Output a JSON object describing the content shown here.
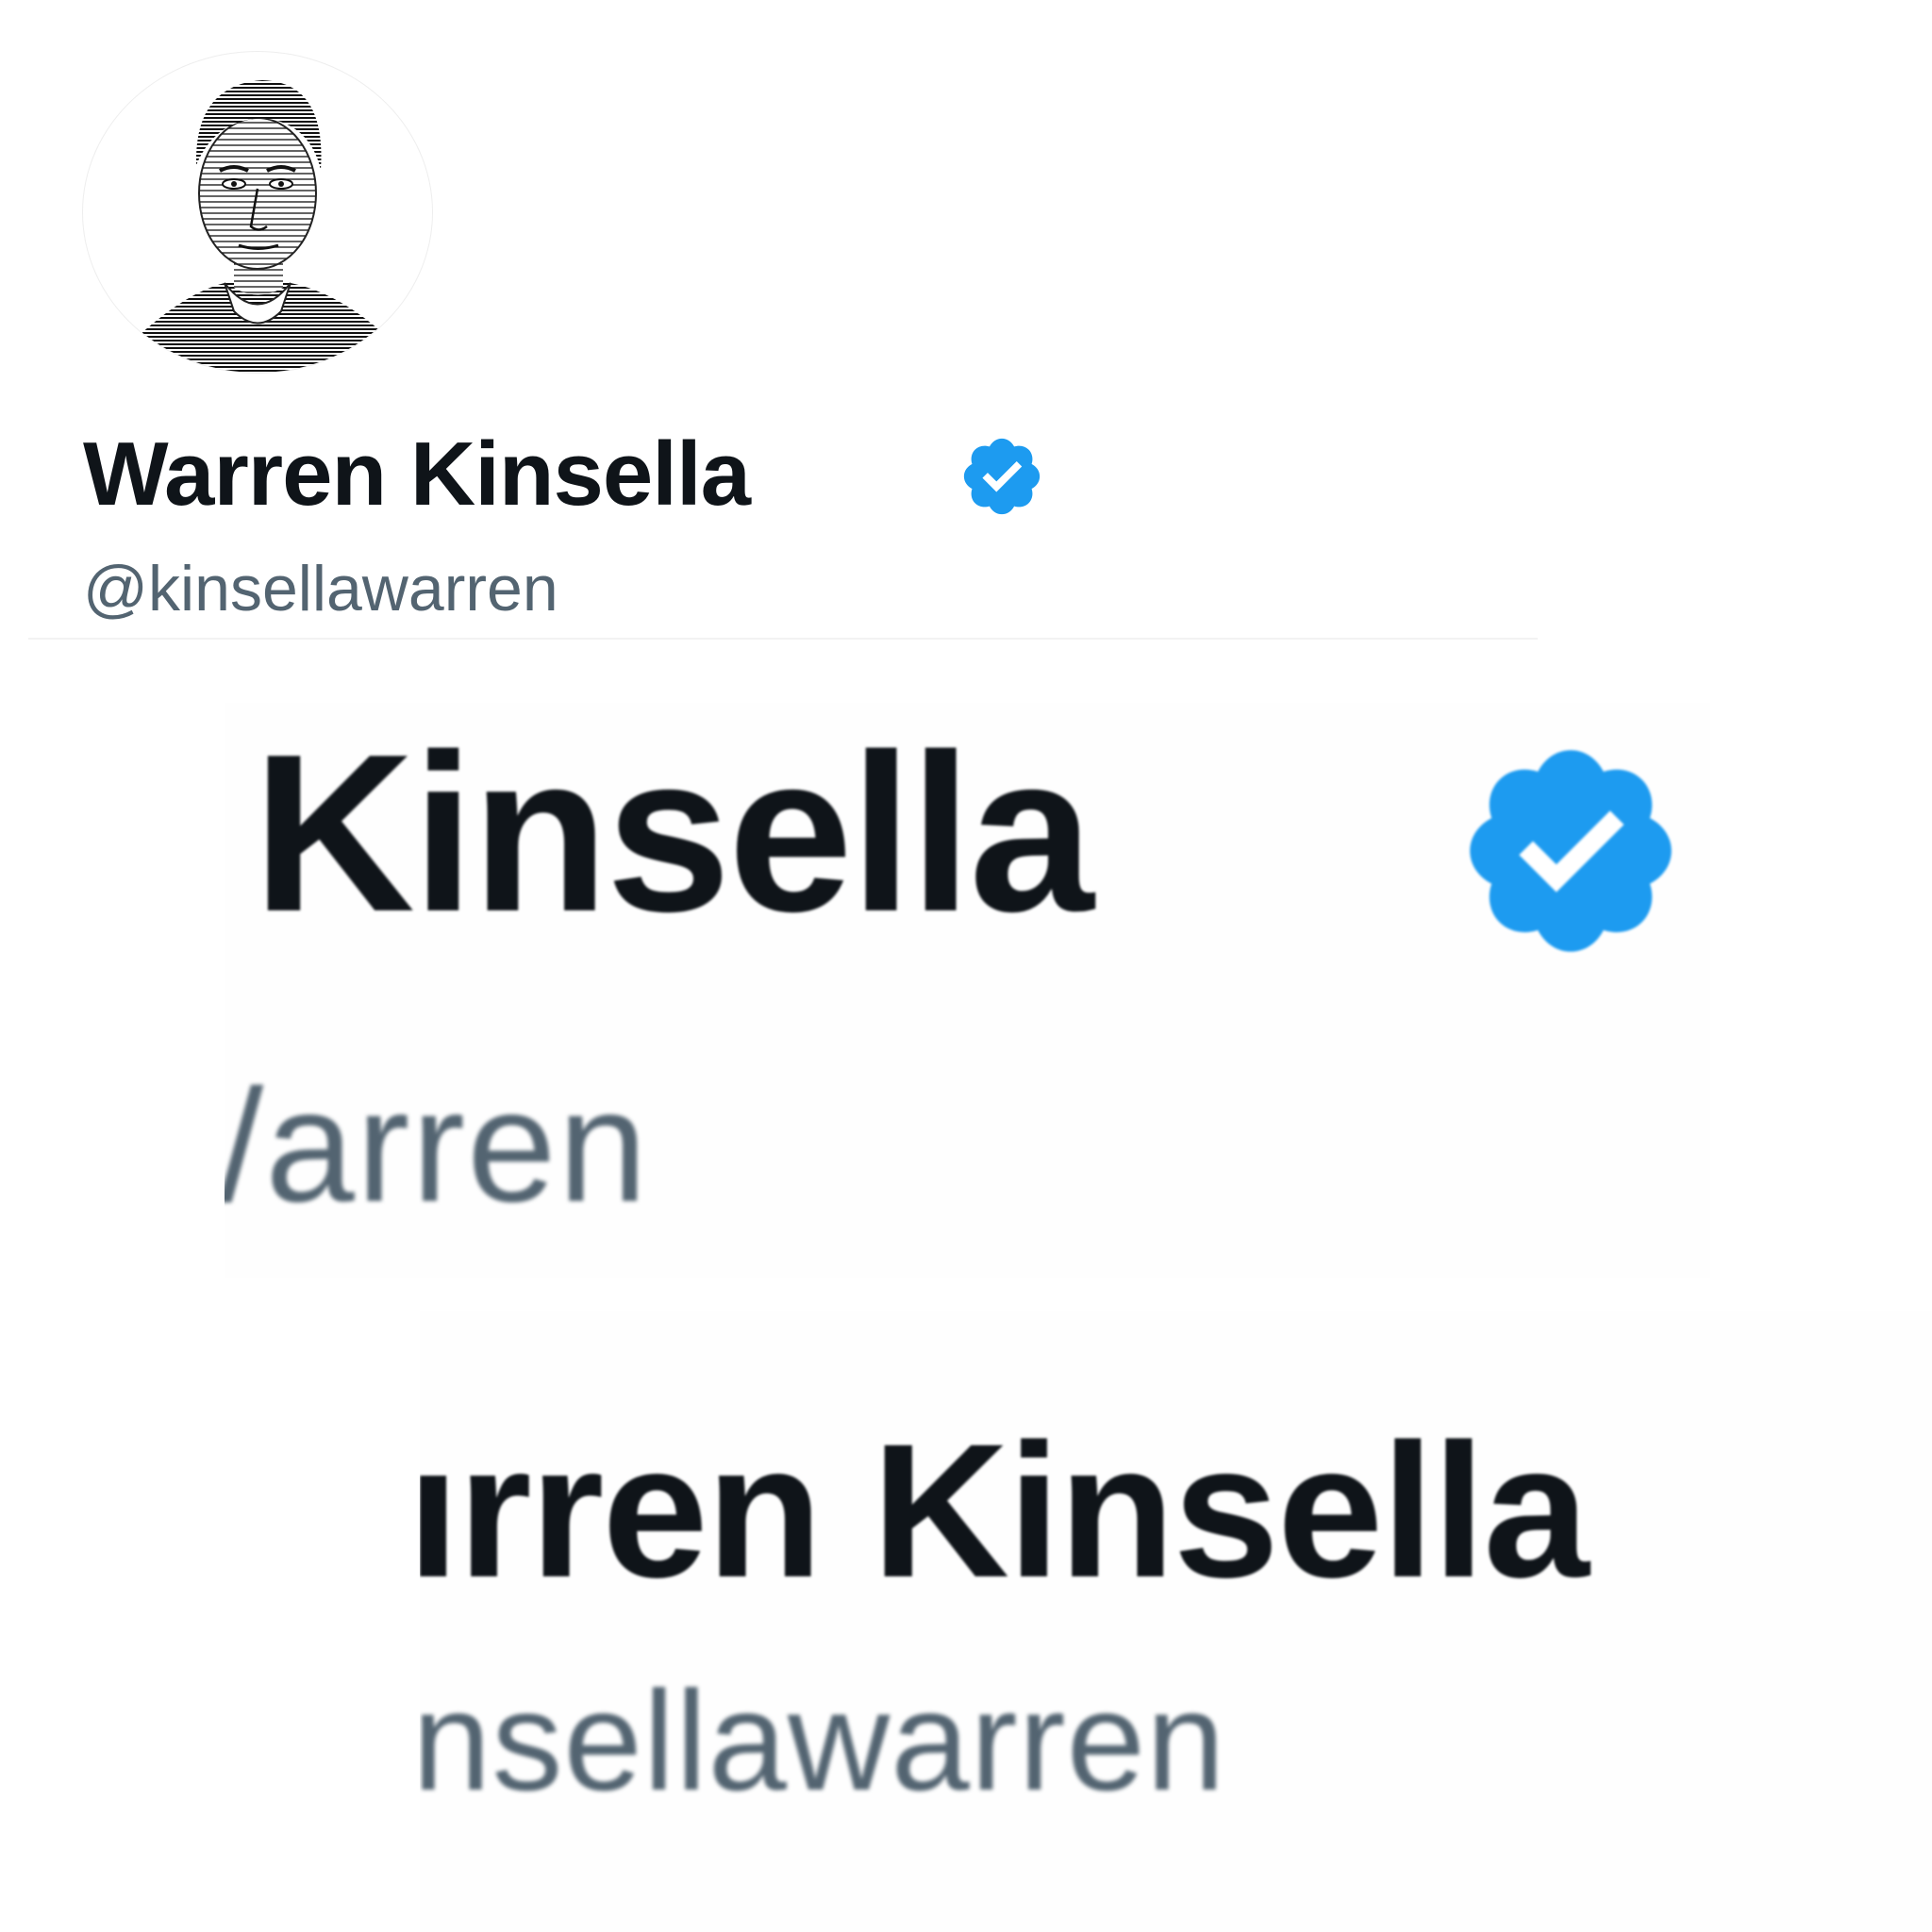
{
  "profile": {
    "display_name": "Warren Kinsella",
    "handle": "@kinsellawarren",
    "avatar_icon": "engraved-portrait-avatar",
    "verified_icon": "verified-badge-icon"
  },
  "zoom_crop_1": {
    "name_fragment": "Kinsella",
    "handle_fragment": "/arren",
    "verified_icon": "verified-badge-icon"
  },
  "zoom_crop_2": {
    "name_fragment": "ırren Kinsella",
    "handle_fragment": "nsellawarren"
  },
  "colors": {
    "name_text": "#0f1419",
    "handle_text": "#536471",
    "verified_blue": "#1d9bf0",
    "background": "#ffffff"
  }
}
